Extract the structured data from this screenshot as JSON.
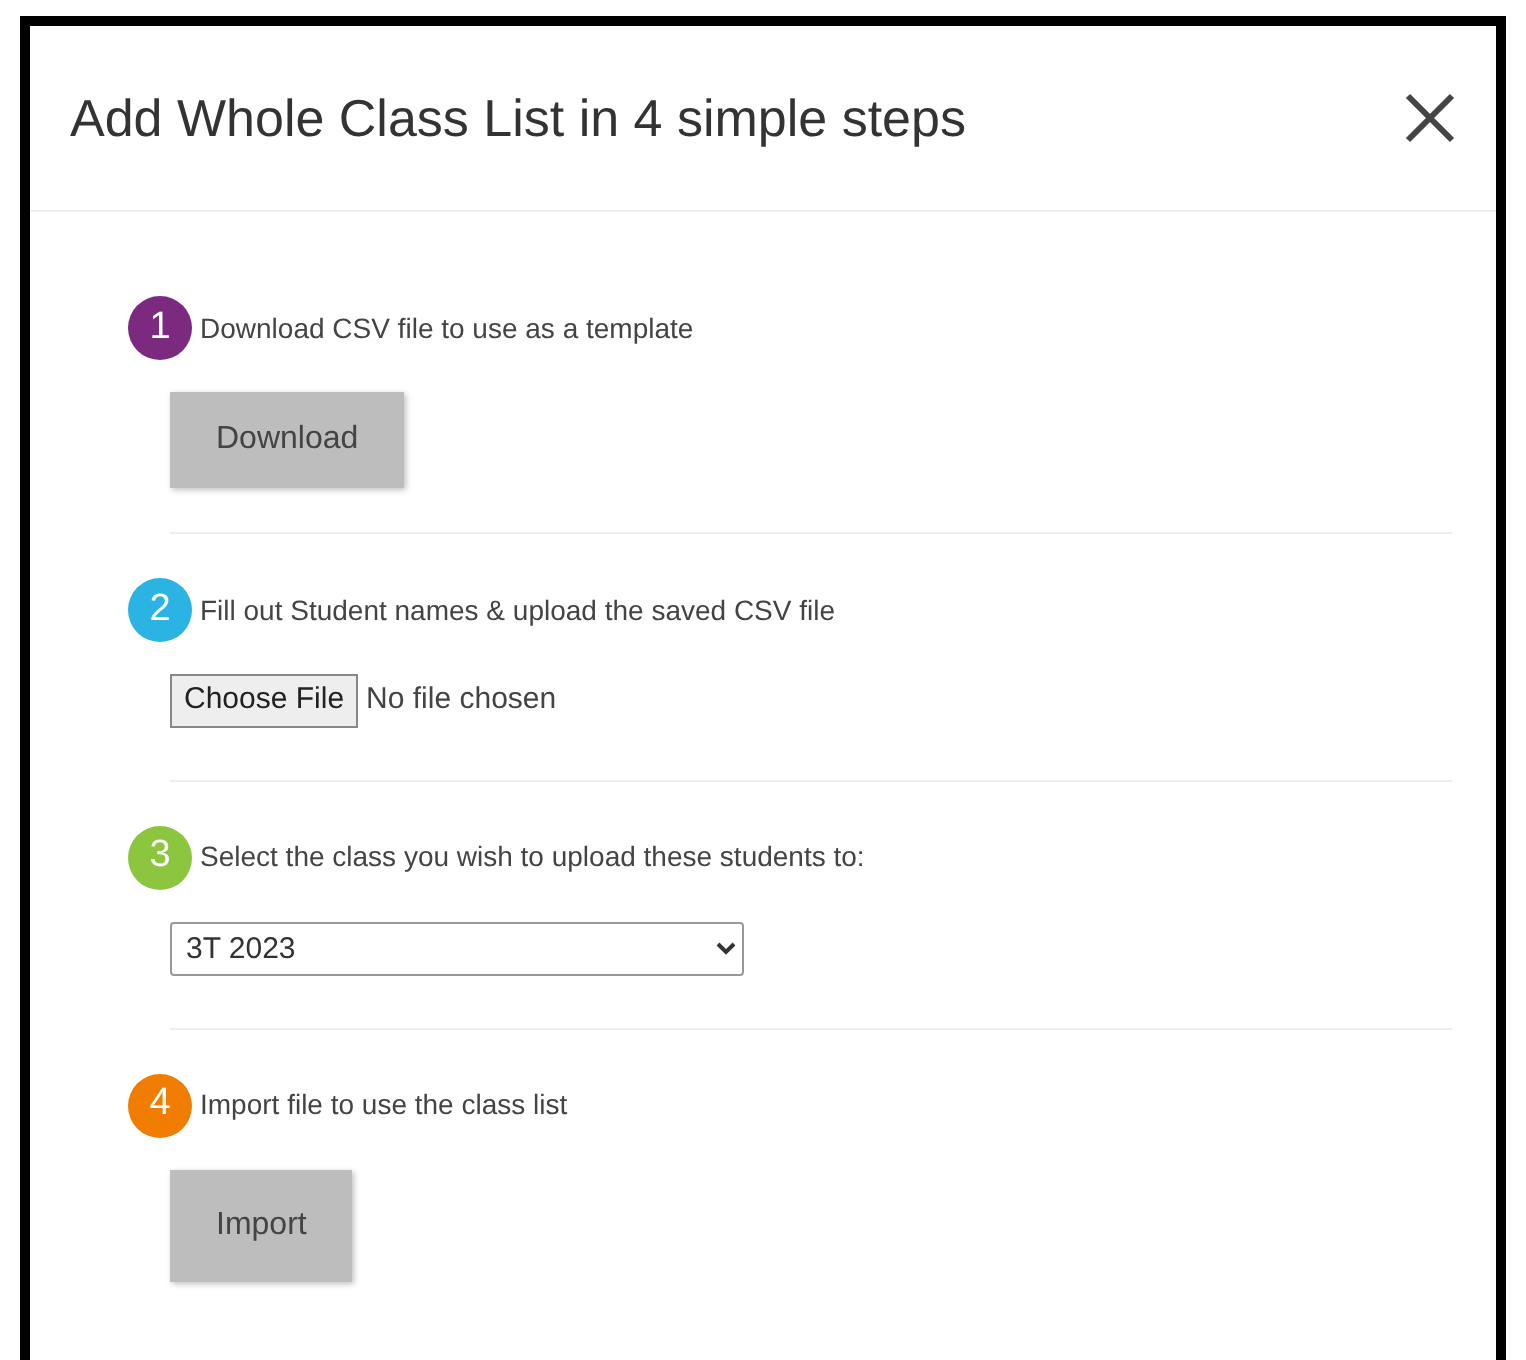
{
  "dialog": {
    "title": "Add Whole Class List in 4 simple steps"
  },
  "steps": [
    {
      "number": "1",
      "color": "#7b2a7f",
      "label": "Download CSV file to use as a template",
      "kind": "button",
      "button": "Download"
    },
    {
      "number": "2",
      "color": "#2bb3e3",
      "label": "Fill out Student names & upload the saved CSV file",
      "kind": "file",
      "button": "Choose File",
      "status": "No file chosen"
    },
    {
      "number": "3",
      "color": "#8cc63f",
      "label": "Select the class you wish to upload these students to:",
      "kind": "select",
      "value": "3T 2023"
    },
    {
      "number": "4",
      "color": "#f07c00",
      "label": "Import file to use the class list",
      "kind": "button",
      "button": "Import"
    }
  ]
}
